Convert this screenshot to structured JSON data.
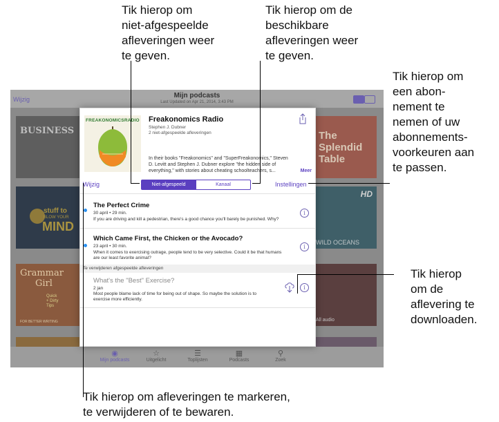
{
  "callouts": {
    "not_played": [
      "Tik hierop om",
      "niet-afgespeelde",
      "afleveringen weer",
      "te geven."
    ],
    "available": [
      "Tik hierop om de",
      "beschikbare",
      "afleveringen weer",
      "te geven."
    ],
    "subscribe": [
      "Tik hierop om",
      "een abon-",
      "nement te",
      "nemen of uw",
      "abonnements-",
      "voorkeuren aan",
      "te passen."
    ],
    "download": [
      "Tik hierop",
      "om de",
      "aflevering te",
      "downloaden."
    ],
    "mark": [
      "Tik hierop om afleveringen te markeren,",
      "te verwijderen of te bewaren."
    ]
  },
  "topbar": {
    "edit": "Wijzig",
    "title": "Mijn podcasts",
    "subtitle": "Last Updated on Apr 21, 2014, 3:43 PM"
  },
  "tiles": {
    "business": "BUSINESS",
    "splendid": [
      "The",
      "Splendid",
      "Table"
    ],
    "stuff_small": "stuff to",
    "stuff_blow": "BLOW YOUR",
    "stuff_mind": "MIND",
    "hd": "HD",
    "wild_oceans": "WILD OCEANS",
    "grammar": [
      "Grammar",
      "Girl"
    ],
    "grammar_tips": [
      "Quick",
      "+ Dirty",
      "Tips"
    ],
    "grammar_footer": "FOR BETTER WRITING",
    "all_audio": "All audio"
  },
  "tabbar": [
    "Mijn podcasts",
    "Uitgelicht",
    "Toplijsten",
    "Podcasts",
    "Zoek"
  ],
  "podcast": {
    "logo": "FREAKONOMICSRADIO",
    "title": "Freakonomics Radio",
    "author": "Stephen J. Dubner",
    "count": "2 niet-afgespeelde afleveringen",
    "description": [
      "In their books \"Freakonomics\" and \"SuperFreakonomics,\" Steven",
      "D. Levitt and Stephen J. Dubner explore \"the hidden side of",
      "everything,\" with stories about cheating schoolteachers, s..."
    ],
    "more": "Meer",
    "share_icon": "share-icon"
  },
  "controls": {
    "edit": "Wijzig",
    "settings": "Instellingen",
    "seg_unplayed": "Niet-afgespeeld",
    "seg_feed": "Kanaal"
  },
  "episodes": [
    {
      "title": "The Perfect Crime",
      "meta": "30 april • 29 min.",
      "desc": [
        "If you are driving and kill a pedestrian, there's a good chance you'll barely be punished. Why?"
      ]
    },
    {
      "title": "Which Came First, the Chicken or the Avocado?",
      "meta": "23 april • 30 min.",
      "desc": [
        "When it comes to exercising outrage, people tend to be very selective. Could it be that humans",
        "are our least favorite animal?"
      ]
    }
  ],
  "section_header": "Te verwijderen afgespeelde afleveringen",
  "played_episode": {
    "title": "What's the \"Best\" Exercise?",
    "meta": "2 jan",
    "desc": [
      "Most people blame lack of time for being out of shape. So maybe the solution is to",
      "exercise more efficiently."
    ]
  },
  "colors": {
    "accent": "#5a3fc0",
    "unplayed_dot": "#2a90f0"
  }
}
